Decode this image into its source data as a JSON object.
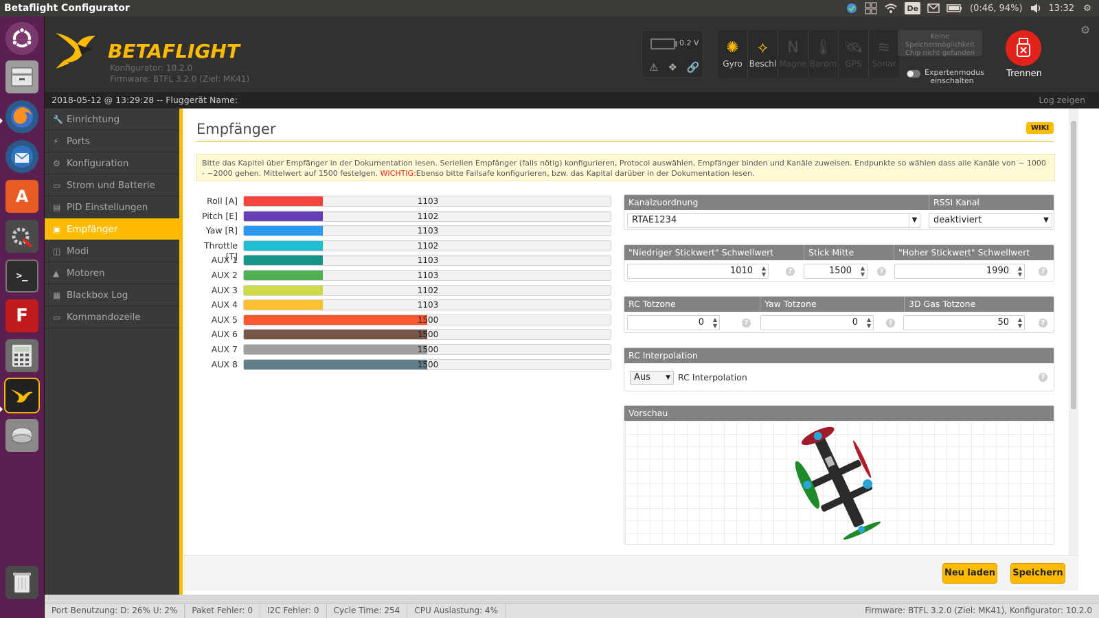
{
  "topbar": {
    "title": "Betaflight Configurator",
    "keyboard": "De",
    "battery": "(0:46, 94%)",
    "time": "13:32"
  },
  "launcher": [
    "ubuntu-dash",
    "files",
    "firefox",
    "thunderbird",
    "software-center",
    "system-settings",
    "terminal",
    "filezilla",
    "calculator",
    "betaflight-configurator",
    "disks",
    "trash"
  ],
  "header": {
    "logo": "BETAFLIGHT",
    "configurator_version": "Konfigurator: 10.2.0",
    "firmware_version": "Firmware: BTFL 3.2.0 (Ziel: MK41)",
    "voltage": "0.2 V",
    "sensors": [
      {
        "label": "Gyro",
        "icon": "gyro-icon",
        "active": true
      },
      {
        "label": "Beschl",
        "icon": "accelerometer-icon",
        "active": true
      },
      {
        "label": "Magne",
        "icon": "magnetometer-icon",
        "active": false
      },
      {
        "label": "Barom",
        "icon": "barometer-icon",
        "active": false
      },
      {
        "label": "GPS",
        "icon": "gps-icon",
        "active": false
      },
      {
        "label": "Sonar",
        "icon": "sonar-icon",
        "active": false
      }
    ],
    "flash_line1": "Keine Speichermöglichkeit",
    "flash_line2": "Chip nicht gefunden",
    "expert_line1": "Expertenmodus",
    "expert_line2": "einschalten",
    "disconnect": "Trennen"
  },
  "infobar": {
    "text": "2018-05-12 @ 13:29:28 -- Fluggerät Name:",
    "log": "Log zeigen"
  },
  "nav": [
    {
      "label": "Einrichtung",
      "icon": "wrench-icon",
      "active": false
    },
    {
      "label": "Ports",
      "icon": "plug-icon",
      "active": false
    },
    {
      "label": "Konfiguration",
      "icon": "gear-icon",
      "active": false
    },
    {
      "label": "Strom und Batterie",
      "icon": "battery-icon",
      "active": false
    },
    {
      "label": "PID Einstellungen",
      "icon": "sliders-icon",
      "active": false
    },
    {
      "label": "Empfänger",
      "icon": "receiver-icon",
      "active": true
    },
    {
      "label": "Modi",
      "icon": "modes-icon",
      "active": false
    },
    {
      "label": "Motoren",
      "icon": "motor-icon",
      "active": false
    },
    {
      "label": "Blackbox Log",
      "icon": "blackbox-icon",
      "active": false
    },
    {
      "label": "Kommandozeile",
      "icon": "cli-icon",
      "active": false
    }
  ],
  "content": {
    "title": "Empfänger",
    "wiki": "WIKI",
    "note_text": "Bitte das Kapitel über Empfänger in der Dokumentation lesen. Seriellen Empfänger (falls nötig) konfigurieren, Protocol auswählen, Empfänger binden und Kanäle zuweisen. Endpunkte so wählen dass alle Kanäle von ~ 1000 - ~2000 gehen. Mittelwert auf 1500 festelgen. ",
    "note_warn": "WICHTIG:",
    "note_rest": "Ebenso bitte Failsafe konfigurieren, bzw. das Kapital darüber in der Dokumentation lesen."
  },
  "channels": [
    {
      "label": "Roll [A]",
      "value": "1103",
      "fraction": 0.216,
      "color": "#f1453d"
    },
    {
      "label": "Pitch [E]",
      "value": "1102",
      "fraction": 0.216,
      "color": "#673fb4"
    },
    {
      "label": "Yaw [R]",
      "value": "1103",
      "fraction": 0.216,
      "color": "#2b98f0"
    },
    {
      "label": "Throttle [T]",
      "value": "1102",
      "fraction": 0.216,
      "color": "#1fbcd2"
    },
    {
      "label": "AUX 1",
      "value": "1103",
      "fraction": 0.216,
      "color": "#159588"
    },
    {
      "label": "AUX 2",
      "value": "1103",
      "fraction": 0.216,
      "color": "#50ae55"
    },
    {
      "label": "AUX 3",
      "value": "1102",
      "fraction": 0.216,
      "color": "#cdda49"
    },
    {
      "label": "AUX 4",
      "value": "1103",
      "fraction": 0.216,
      "color": "#fdc02f"
    },
    {
      "label": "AUX 5",
      "value": "1500",
      "fraction": 0.5,
      "color": "#fc5830"
    },
    {
      "label": "AUX 6",
      "value": "1500",
      "fraction": 0.5,
      "color": "#785549"
    },
    {
      "label": "AUX 7",
      "value": "1500",
      "fraction": 0.5,
      "color": "#9e9e9e"
    },
    {
      "label": "AUX 8",
      "value": "1500",
      "fraction": 0.5,
      "color": "#617d8a"
    }
  ],
  "channel_map": {
    "header_map": "Kanalzuordnung",
    "header_rssi": "RSSI Kanal",
    "map_value": "RTAE1234",
    "rssi_value": "deaktiviert"
  },
  "sticks": {
    "h_low": "\"Niedriger Stickwert\" Schwellwert",
    "h_mid": "Stick Mitte",
    "h_high": "\"Hoher Stickwert\" Schwellwert",
    "low": "1010",
    "mid": "1500",
    "high": "1990"
  },
  "deadband": {
    "h_rc": "RC Totzone",
    "h_yaw": "Yaw Totzone",
    "h_3d": "3D Gas Totzone",
    "rc": "0",
    "yaw": "0",
    "threed": "50"
  },
  "interpolation": {
    "header": "RC Interpolation",
    "select": "Aus",
    "label": "RC Interpolation"
  },
  "preview": {
    "header": "Vorschau"
  },
  "buttons": {
    "refresh": "Neu laden",
    "save": "Speichern"
  },
  "status": {
    "port": "Port Benutzung: D: 26% U: 2%",
    "packet": "Paket Fehler: 0",
    "i2c": "I2C Fehler: 0",
    "cycle": "Cycle Time: 254",
    "cpu": "CPU Auslastung: 4%",
    "firmware": "Firmware: BTFL 3.2.0 (Ziel: MK41), Konfigurator: 10.2.0"
  }
}
